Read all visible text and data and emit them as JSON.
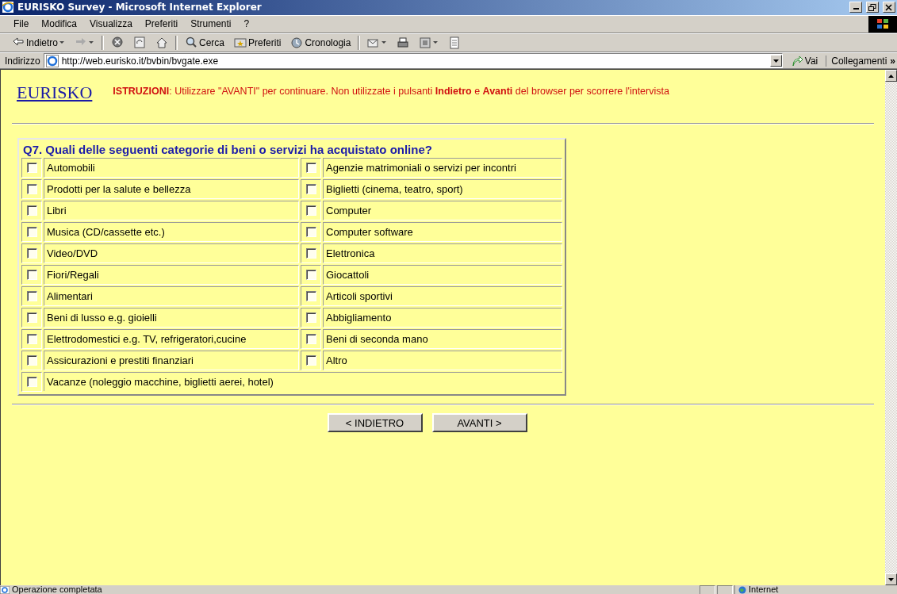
{
  "window": {
    "title": "EURISKO Survey - Microsoft Internet Explorer"
  },
  "menu": [
    "File",
    "Modifica",
    "Visualizza",
    "Preferiti",
    "Strumenti",
    "?"
  ],
  "toolbar": [
    {
      "label": "Indietro",
      "kind": "dropdown"
    },
    {
      "kind": "dropdown"
    },
    {
      "kind": "plain"
    },
    {
      "kind": "plain"
    },
    {
      "kind": "plain"
    },
    {
      "label": "Cerca",
      "kind": "plain"
    },
    {
      "label": "Preferiti",
      "kind": "plain"
    },
    {
      "label": "Cronologia",
      "kind": "plain"
    },
    {
      "kind": "dropdown"
    },
    {
      "kind": "plain"
    },
    {
      "kind": "dropdown"
    },
    {
      "kind": "plain"
    }
  ],
  "address": {
    "label": "Indirizzo",
    "url": "http://web.eurisko.it/bvbin/bvgate.exe",
    "go": "Vai",
    "links": "Collegamenti",
    "more": "»"
  },
  "page": {
    "logo": "EURISKO",
    "instructions": "**ISTRUZIONI**: Utilizzare \"AVANTI\" per continuare. Non utilizzate i pulsanti **Indietro** e **Avanti** del browser per scorrere l'intervista",
    "question": "Q7. Quali delle seguenti categorie di beni o servizi ha acquistato online?",
    "options": [
      {
        "label": "Automobili",
        "checked": false
      },
      {
        "label": "Agenzie matrimoniali o servizi per incontri",
        "checked": false
      },
      {
        "label": "Prodotti per la salute e bellezza",
        "checked": false
      },
      {
        "label": "Biglietti (cinema, teatro, sport)",
        "checked": false
      },
      {
        "label": "Libri",
        "checked": false
      },
      {
        "label": "Computer",
        "checked": false
      },
      {
        "label": "Musica (CD/cassette etc.)",
        "checked": false
      },
      {
        "label": "Computer software",
        "checked": false
      },
      {
        "label": "Video/DVD",
        "checked": false
      },
      {
        "label": "Elettronica",
        "checked": false
      },
      {
        "label": "Fiori/Regali",
        "checked": false
      },
      {
        "label": "Giocattoli",
        "checked": false
      },
      {
        "label": "Alimentari",
        "checked": false
      },
      {
        "label": "Articoli sportivi",
        "checked": false
      },
      {
        "label": "Beni di lusso e.g. gioielli",
        "checked": false
      },
      {
        "label": "Abbigliamento",
        "checked": false
      },
      {
        "label": "Elettrodomestici e.g. TV, refrigeratori,cucine",
        "checked": false
      },
      {
        "label": "Beni di seconda mano",
        "checked": false
      },
      {
        "label": "Assicurazioni e prestiti finanziari",
        "checked": false
      },
      {
        "label": "Altro",
        "checked": false
      },
      {
        "label": "Vacanze (noleggio macchine, biglietti aerei, hotel)",
        "checked": false
      }
    ],
    "buttons": [
      "< INDIETRO",
      "AVANTI >"
    ]
  },
  "status_bar": {
    "message": "Operazione completata",
    "zone": "Internet"
  }
}
